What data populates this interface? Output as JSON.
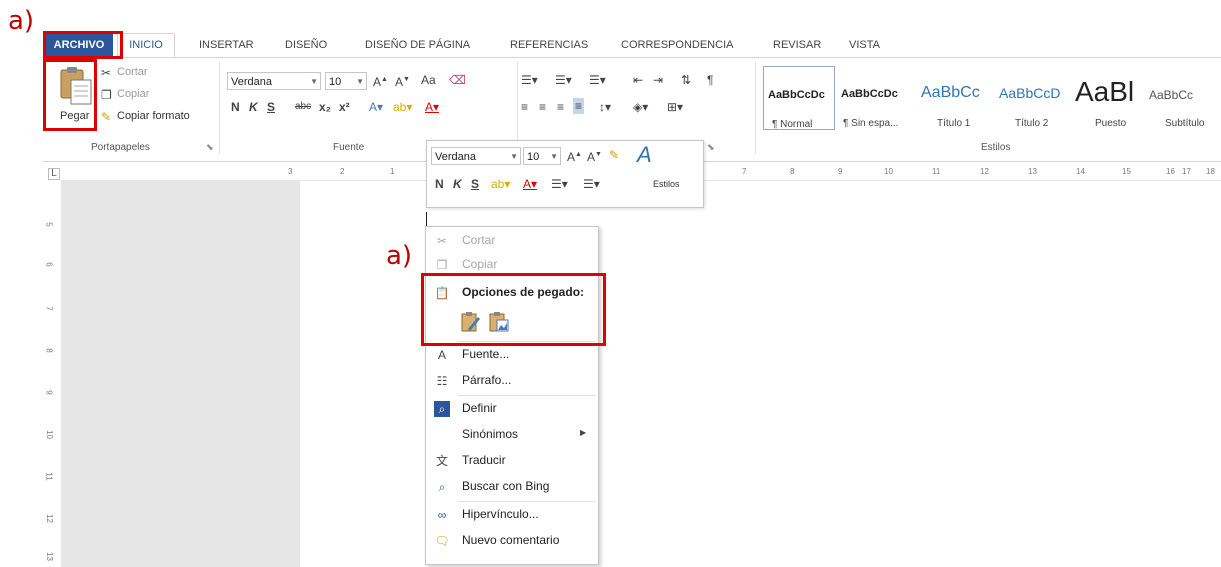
{
  "annotations": {
    "label_top": "a)",
    "label_menu": "a)"
  },
  "ribbon_tabs": [
    "ARCHIVO",
    "INICIO",
    "INSERTAR",
    "DISEÑO",
    "DISEÑO DE PÁGINA",
    "REFERENCIAS",
    "CORRESPONDENCIA",
    "REVISAR",
    "VISTA"
  ],
  "clipboard": {
    "paste_label": "Pegar",
    "cut_label": "Cortar",
    "copy_label": "Copiar",
    "format_painter_label": "Copiar formato",
    "group_label": "Portapapeles"
  },
  "font": {
    "font_name": "Verdana",
    "font_size": "10",
    "group_label": "Fuente",
    "bold": "N",
    "italic": "K",
    "underline": "S",
    "strike": "abc",
    "subscript": "x₂",
    "superscript": "x²",
    "change_case": "Aa"
  },
  "styles": {
    "group_label": "Estilos",
    "items": [
      {
        "sample": "AaBbCcDc",
        "name": "¶ Normal"
      },
      {
        "sample": "AaBbCcDc",
        "name": "¶ Sin espa..."
      },
      {
        "sample": "AaBbCc",
        "name": "Título 1"
      },
      {
        "sample": "AaBbCcD",
        "name": "Título 2"
      },
      {
        "sample": "AaBl",
        "name": "Puesto"
      },
      {
        "sample": "AaBbCc",
        "name": "Subtítulo"
      }
    ]
  },
  "ruler": {
    "labels": [
      "3",
      "2",
      "1",
      "7",
      "8",
      "9",
      "10",
      "11",
      "12",
      "13",
      "14",
      "15",
      "16",
      "17",
      "18"
    ],
    "vlabels": [
      "5",
      "6",
      "7",
      "8",
      "9",
      "10",
      "11",
      "12",
      "13"
    ],
    "corner": "L"
  },
  "mini_toolbar": {
    "font_name": "Verdana",
    "font_size": "10",
    "styles_label": "Estilos",
    "bold": "N",
    "italic": "K",
    "underline": "S"
  },
  "context_menu": {
    "cut": "Cortar",
    "copy": "Copiar",
    "paste_options": "Opciones de pegado:",
    "font": "Fuente...",
    "paragraph": "Párrafo...",
    "define": "Definir",
    "synonyms": "Sinónimos",
    "translate": "Traducir",
    "bing": "Buscar con Bing",
    "hyperlink": "Hipervínculo...",
    "new_comment": "Nuevo comentario"
  },
  "colors": {
    "file_tab": "#2b579a",
    "highlight_box": "#e00000",
    "accent": "#2b579a"
  }
}
